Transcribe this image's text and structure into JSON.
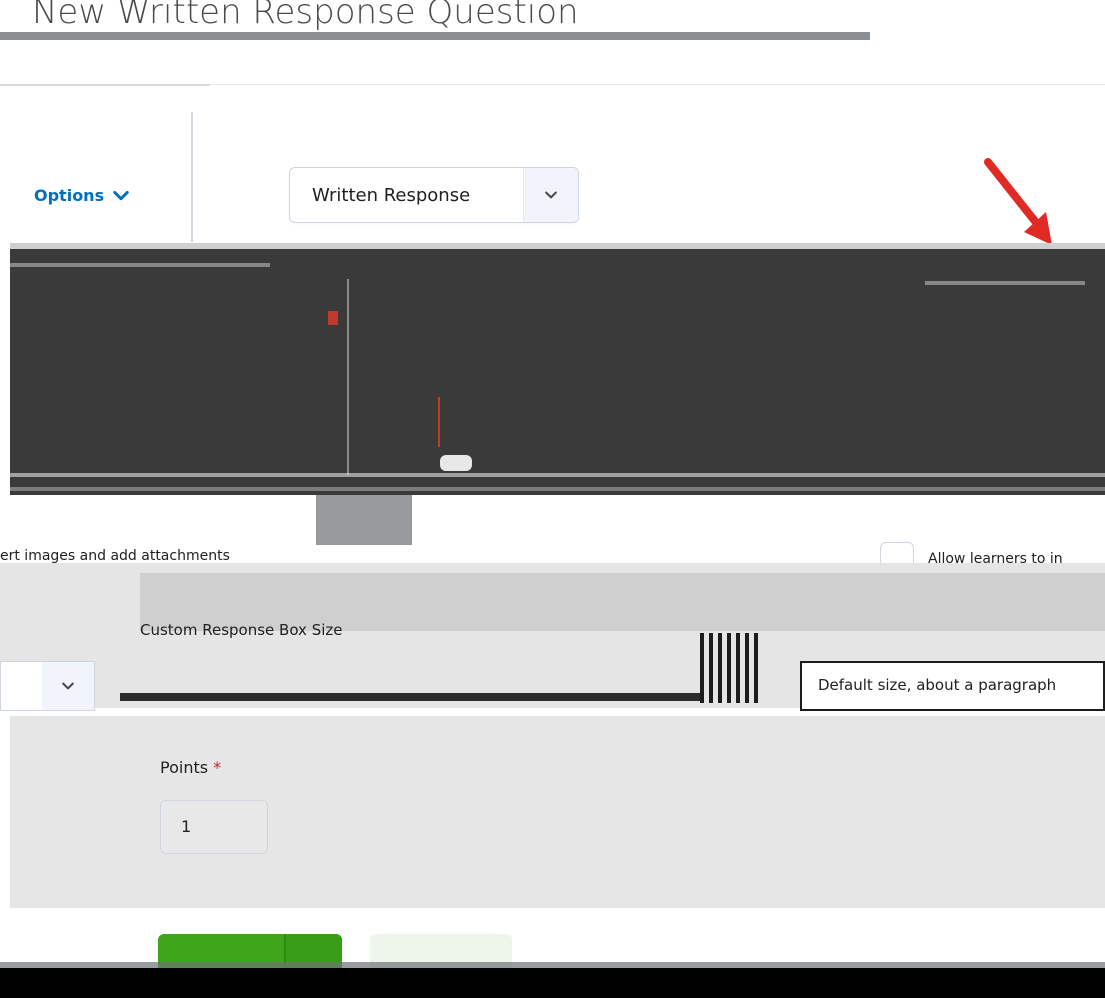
{
  "page": {
    "title": "New Written Response Question"
  },
  "sidebar": {
    "options_label": "Options"
  },
  "question_type": {
    "selected": "Written Response"
  },
  "attachments": {
    "text": "ert images and add attachments",
    "allow_label": "Allow learners to in"
  },
  "response_box": {
    "label": "Custom Response Box Size",
    "selected": "Default size, about a paragraph"
  },
  "points": {
    "label": "Points",
    "required_mark": "*",
    "value": "1"
  },
  "colors": {
    "accent": "#006fbf",
    "save_green": "#3fa51b",
    "arrow_red": "#e02a24"
  }
}
